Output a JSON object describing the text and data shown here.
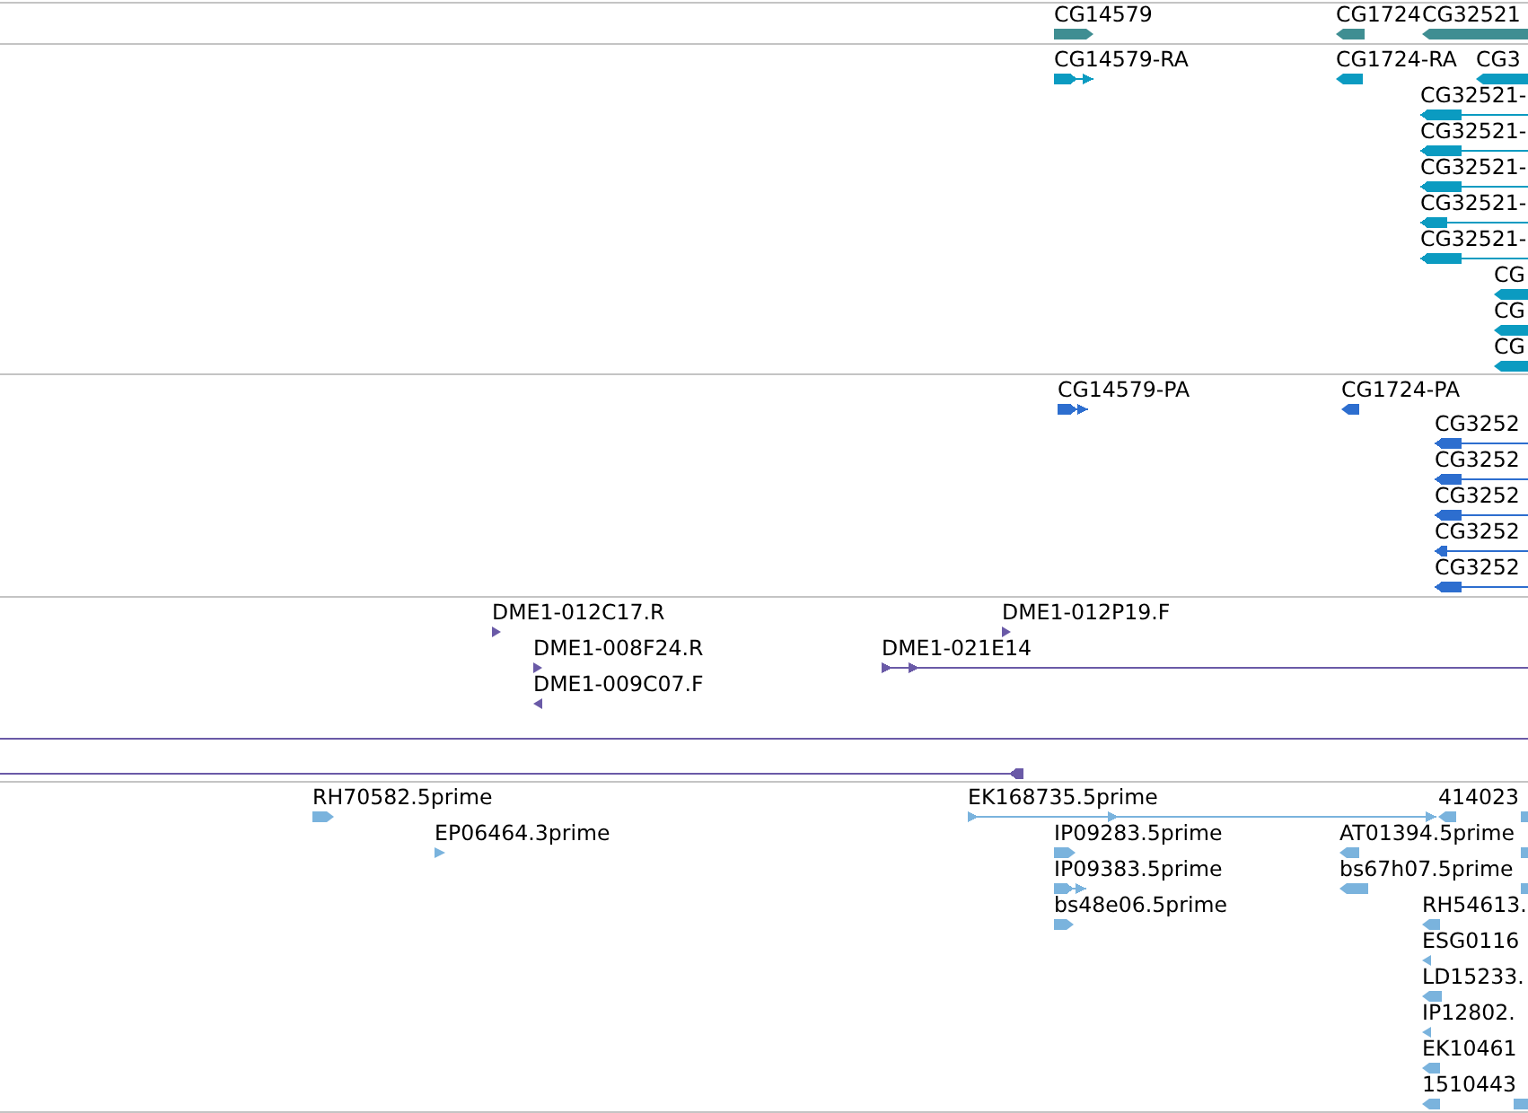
{
  "tracks": [
    {
      "color": "#3f8e92",
      "features": [
        {
          "label": "CG14579",
          "kind": "block",
          "reverse": false
        },
        {
          "label": "CG1724",
          "kind": "block",
          "reverse": true
        },
        {
          "label": "CG32521",
          "kind": "block",
          "reverse": true
        }
      ]
    },
    {
      "color": "#0b9bc1",
      "features": [
        {
          "label": "CG14579-RA",
          "kind": "linked",
          "reverse": false
        },
        {
          "label": "CG1724-RA",
          "kind": "block",
          "reverse": true
        },
        {
          "label": "CG3",
          "kind": "block",
          "reverse": true
        },
        {
          "label": "CG32521-",
          "kind": "linked",
          "reverse": true
        },
        {
          "label": "CG32521-",
          "kind": "linked",
          "reverse": true
        },
        {
          "label": "CG32521-",
          "kind": "linked",
          "reverse": true
        },
        {
          "label": "CG32521-",
          "kind": "linked",
          "reverse": true
        },
        {
          "label": "CG32521-",
          "kind": "linked",
          "reverse": true
        },
        {
          "label": "CG",
          "kind": "block",
          "reverse": true
        },
        {
          "label": "CG",
          "kind": "block",
          "reverse": true
        },
        {
          "label": "CG",
          "kind": "block",
          "reverse": true
        }
      ]
    },
    {
      "color": "#2d6ecf",
      "features": [
        {
          "label": "CG14579-PA",
          "kind": "linked",
          "reverse": false
        },
        {
          "label": "CG1724-PA",
          "kind": "block",
          "reverse": true
        },
        {
          "label": "CG3252",
          "kind": "linked",
          "reverse": true
        },
        {
          "label": "CG3252",
          "kind": "linked",
          "reverse": true
        },
        {
          "label": "CG3252",
          "kind": "linked",
          "reverse": true
        },
        {
          "label": "CG3252",
          "kind": "linked",
          "reverse": true
        },
        {
          "label": "CG3252",
          "kind": "linked",
          "reverse": true
        }
      ]
    },
    {
      "color": "#6a5aa7",
      "features": [
        {
          "label": "DME1-012C17.R",
          "kind": "block",
          "reverse": false
        },
        {
          "label": "DME1-008F24.R",
          "kind": "block",
          "reverse": false
        },
        {
          "label": "DME1-009C07.F",
          "kind": "block",
          "reverse": true
        },
        {
          "label": "DME1-012P19.F",
          "kind": "block",
          "reverse": false
        },
        {
          "label": "DME1-021E14",
          "kind": "linked",
          "reverse": false
        },
        {
          "kind": "line"
        },
        {
          "kind": "linked",
          "reverse": true
        }
      ]
    },
    {
      "color": "#7ab3dd",
      "features": [
        {
          "label": "RH70582.5prime",
          "kind": "block",
          "reverse": false
        },
        {
          "label": "EP06464.3prime",
          "kind": "block",
          "reverse": false
        },
        {
          "label": "EK168735.5prime",
          "kind": "linked",
          "reverse": false
        },
        {
          "label": "IP09283.5prime",
          "kind": "block",
          "reverse": false
        },
        {
          "label": "IP09383.5prime",
          "kind": "linked",
          "reverse": false
        },
        {
          "label": "bs48e06.5prime",
          "kind": "block",
          "reverse": false
        },
        {
          "label": "414023",
          "kind": "block",
          "reverse": true
        },
        {
          "label": "AT01394.5prime",
          "kind": "block",
          "reverse": true
        },
        {
          "label": "bs67h07.5prime",
          "kind": "block",
          "reverse": true
        },
        {
          "label": "RH54613.",
          "kind": "block",
          "reverse": true
        },
        {
          "label": "ESG0116",
          "kind": "block",
          "reverse": true
        },
        {
          "label": "LD15233.",
          "kind": "block",
          "reverse": true
        },
        {
          "label": "IP12802.",
          "kind": "block",
          "reverse": true
        },
        {
          "label": "EK10461",
          "kind": "block",
          "reverse": true
        },
        {
          "label": "1510443",
          "kind": "block",
          "reverse": true
        },
        {
          "kind": "stub"
        },
        {
          "kind": "stub"
        },
        {
          "kind": "stub"
        },
        {
          "kind": "stub"
        }
      ]
    }
  ]
}
